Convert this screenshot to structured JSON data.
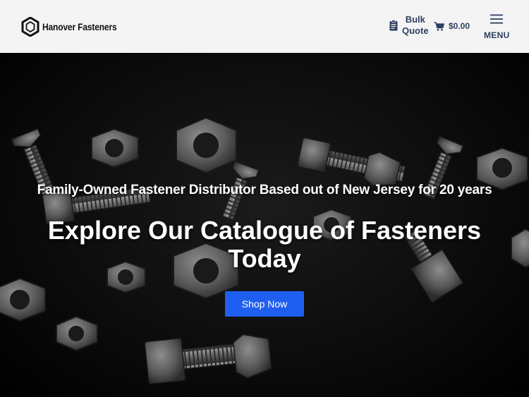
{
  "header": {
    "brand": "Hanover Fasteners",
    "bulk_quote": [
      "Bulk",
      "Quote"
    ],
    "cart_total": "$0.00",
    "menu_label": "MENU"
  },
  "hero": {
    "subtitle": "Family-Owned Fastener Distributor Based out of New Jersey for 20 years",
    "title_line1": "Explore Our Catalogue of Fasteners",
    "title_line2": "Today",
    "cta_label": "Shop Now"
  },
  "colors": {
    "header_bg": "#f4f4f4",
    "nav_text": "#2f3f60",
    "cta": "#1f5ff0"
  },
  "icons": {
    "logo": "hexagon-nut-icon",
    "bulk_quote": "clipboard-icon",
    "cart": "cart-icon",
    "menu": "hamburger-icon"
  }
}
